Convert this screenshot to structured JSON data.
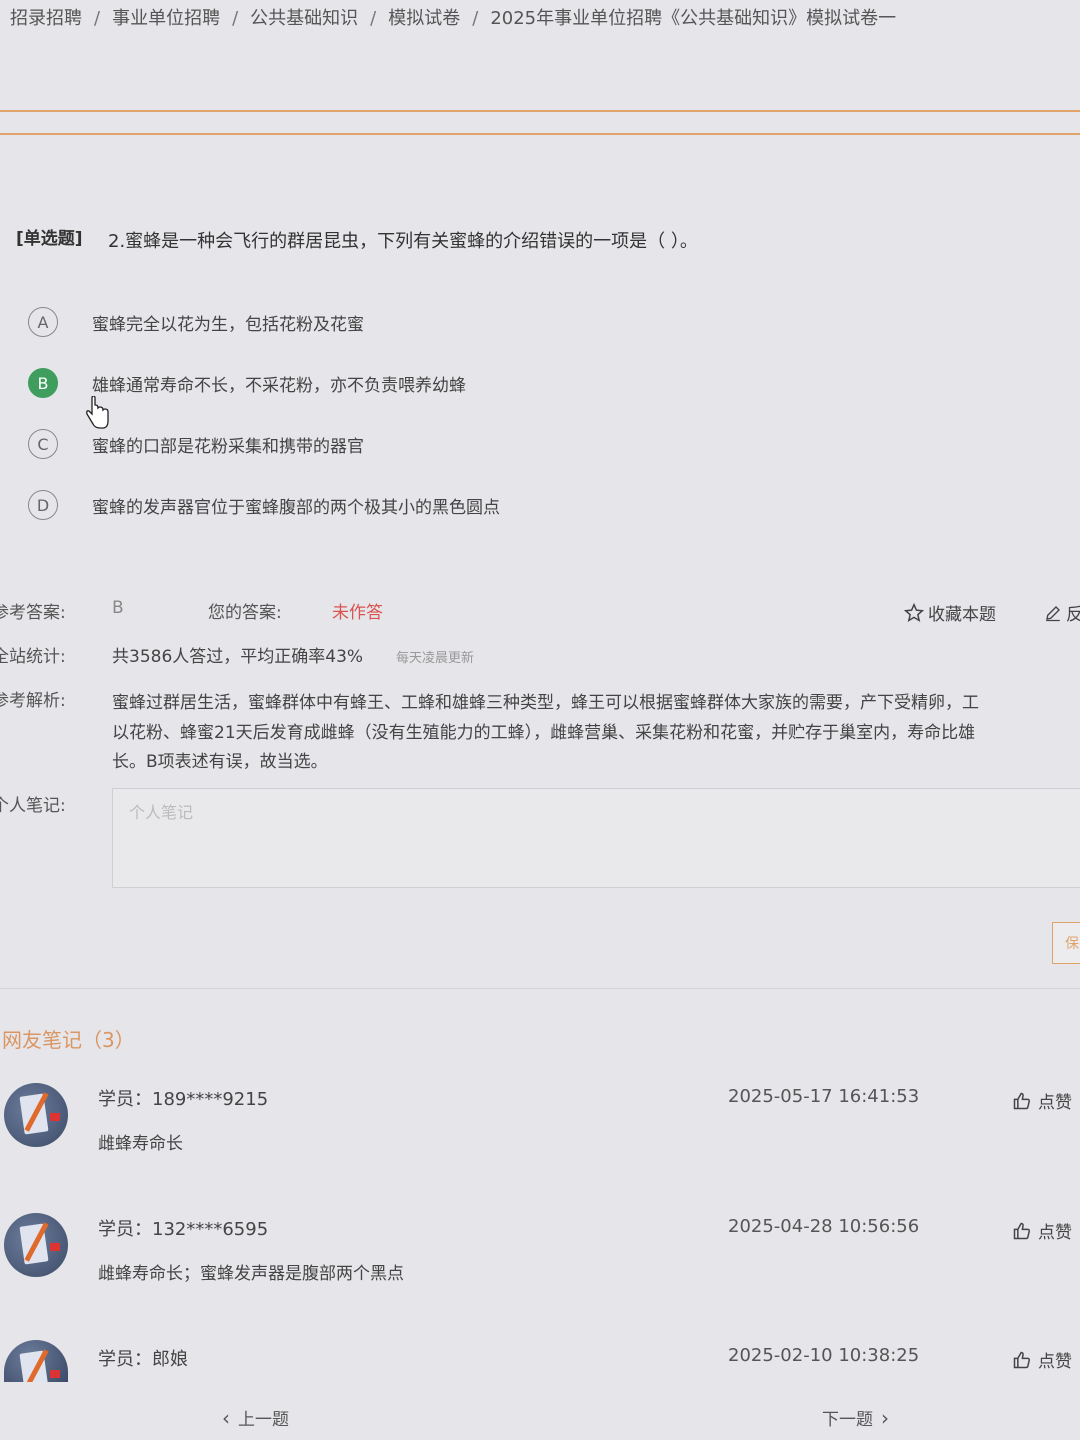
{
  "breadcrumb": [
    "招录招聘",
    "事业单位招聘",
    "公共基础知识",
    "模拟试卷",
    "2025年事业单位招聘《公共基础知识》模拟试卷一"
  ],
  "question": {
    "type": "[单选题]",
    "text": "2.蜜蜂是一种会飞行的群居昆虫，下列有关蜜蜂的介绍错误的一项是（   ）。",
    "options": [
      {
        "letter": "A",
        "text": "蜜蜂完全以花为生，包括花粉及花蜜",
        "selected": false
      },
      {
        "letter": "B",
        "text": "雄蜂通常寿命不长，不采花粉，亦不负责喂养幼蜂",
        "selected": true
      },
      {
        "letter": "C",
        "text": "蜜蜂的口部是花粉采集和携带的器官",
        "selected": false
      },
      {
        "letter": "D",
        "text": "蜜蜂的发声器官位于蜜蜂腹部的两个极其小的黑色圆点",
        "selected": false
      }
    ]
  },
  "answer": {
    "ref_label": "参考答案:",
    "ref_value": "B",
    "your_label": "您的答案:",
    "your_value": "未作答",
    "favorite_label": "收藏本题",
    "feedback_label": "反"
  },
  "stats": {
    "label": "全站统计:",
    "text": "共3586人答过，平均正确率43%",
    "note": "每天凌晨更新"
  },
  "analysis": {
    "label": "参考解析:",
    "lines": [
      "蜜蜂过群居生活，蜜蜂群体中有蜂王、工蜂和雄蜂三种类型，蜂王可以根据蜜蜂群体大家族的需要，产下受精卵，工",
      "以花粉、蜂蜜21天后发育成雌蜂（没有生殖能力的工蜂），雌蜂营巢、采集花粉和花蜜，并贮存于巢室内，寿命比雄",
      "长。B项表述有误，故当选。"
    ]
  },
  "note": {
    "label": "个人笔记:",
    "placeholder": "个人笔记",
    "side_button": "保"
  },
  "comments": {
    "title": "网友笔记（3）",
    "items": [
      {
        "user": "学员：189****9215",
        "time": "2025-05-17 16:41:53",
        "text": "雌蜂寿命长",
        "like": "点赞"
      },
      {
        "user": "学员：132****6595",
        "time": "2025-04-28 10:56:56",
        "text": "雌蜂寿命长；蜜蜂发声器是腹部两个黑点",
        "like": "点赞"
      },
      {
        "user": "学员：郎娘",
        "time": "2025-02-10 10:38:25",
        "text": "",
        "like": "点赞"
      }
    ]
  },
  "pager": {
    "prev": "上一题",
    "next": "下一题"
  },
  "colors": {
    "accent": "#e0a36a",
    "selected": "#3f9e5e",
    "unanswered": "#d9534f"
  }
}
